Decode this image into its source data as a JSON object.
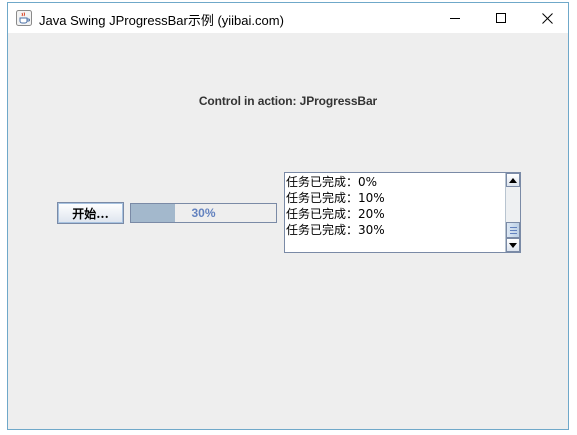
{
  "window": {
    "title": "Java Swing JProgressBar示例 (yiibai.com)",
    "app_icon": "java-cup-icon"
  },
  "title_buttons": {
    "minimize_icon": "minimize-icon",
    "maximize_icon": "maximize-icon",
    "close_icon": "close-icon"
  },
  "content": {
    "header": "Control in action: JProgressBar",
    "start_button": "开始...",
    "progress": {
      "value": 30,
      "label": "30%"
    },
    "log": [
      "任务已完成：0%",
      "任务已完成：10%",
      "任务已完成：20%",
      "任务已完成：30%"
    ]
  },
  "colors": {
    "window_border": "#6fa8c9",
    "client_background": "#eeeeee",
    "progress_fill": "#a3b8cc",
    "progress_text": "#6382bf"
  }
}
